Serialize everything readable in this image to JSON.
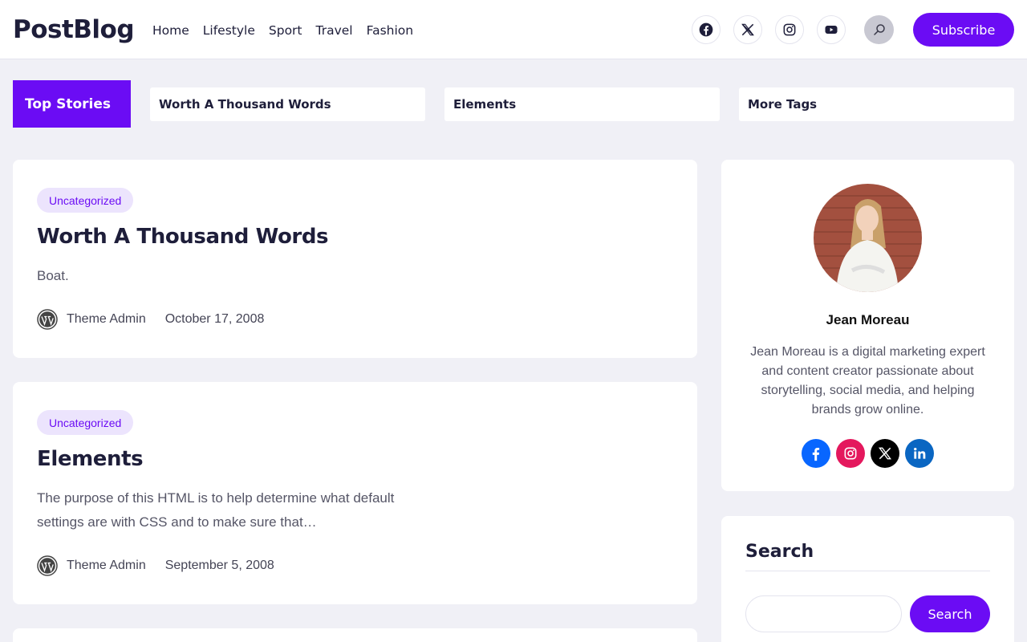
{
  "header": {
    "logo": "PostBlog",
    "nav": [
      "Home",
      "Lifestyle",
      "Sport",
      "Travel",
      "Fashion"
    ],
    "social_icons": [
      "facebook-icon",
      "x-icon",
      "instagram-icon",
      "youtube-icon"
    ],
    "search_icon": "search-icon",
    "subscribe_label": "Subscribe"
  },
  "top_stories": {
    "label": "Top Stories",
    "tags": [
      "Worth A Thousand Words",
      "Elements",
      "More Tags"
    ]
  },
  "posts": [
    {
      "category": "Uncategorized",
      "title": "Worth A Thousand Words",
      "excerpt": "Boat.",
      "author": "Theme Admin",
      "date": "October 17, 2008"
    },
    {
      "category": "Uncategorized",
      "title": "Elements",
      "excerpt": "The purpose of this HTML is to help determine what default settings are with CSS and to make sure that…",
      "author": "Theme Admin",
      "date": "September 5, 2008"
    }
  ],
  "profile": {
    "name": "Jean Moreau",
    "bio": "Jean Moreau is a digital marketing expert and content creator passionate about storytelling, social media, and helping brands grow online.",
    "social_icons": [
      "facebook-icon",
      "instagram-icon",
      "x-icon",
      "linkedin-icon"
    ]
  },
  "search_widget": {
    "title": "Search",
    "button_label": "Search",
    "placeholder": ""
  },
  "colors": {
    "accent": "#6b0cf4",
    "badge_bg": "#ece4fd",
    "page_bg": "#f0f0f6"
  }
}
